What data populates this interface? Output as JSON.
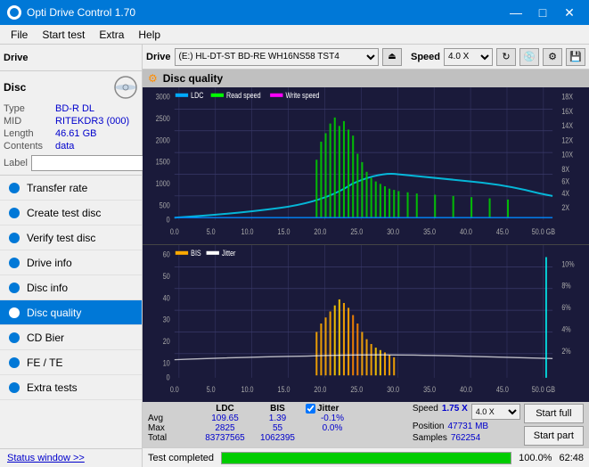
{
  "titleBar": {
    "title": "Opti Drive Control 1.70",
    "controls": [
      "minimize",
      "maximize",
      "close"
    ]
  },
  "menuBar": {
    "items": [
      "File",
      "Start test",
      "Extra",
      "Help"
    ]
  },
  "driveToolbar": {
    "driveLabel": "Drive",
    "driveValue": "(E:)  HL-DT-ST BD-RE  WH16NS58 TST4",
    "speedLabel": "Speed",
    "speedValue": "4.0 X"
  },
  "discPanel": {
    "title": "Disc",
    "rows": [
      {
        "key": "Type",
        "value": "BD-R DL"
      },
      {
        "key": "MID",
        "value": "RITEKDR3 (000)"
      },
      {
        "key": "Length",
        "value": "46.61 GB"
      },
      {
        "key": "Contents",
        "value": "data"
      }
    ],
    "labelKey": "Label"
  },
  "navItems": [
    {
      "id": "transfer-rate",
      "label": "Transfer rate",
      "active": false
    },
    {
      "id": "create-test-disc",
      "label": "Create test disc",
      "active": false
    },
    {
      "id": "verify-test-disc",
      "label": "Verify test disc",
      "active": false
    },
    {
      "id": "drive-info",
      "label": "Drive info",
      "active": false
    },
    {
      "id": "disc-info",
      "label": "Disc info",
      "active": false
    },
    {
      "id": "disc-quality",
      "label": "Disc quality",
      "active": true
    },
    {
      "id": "cd-bier",
      "label": "CD Bier",
      "active": false
    },
    {
      "id": "fe-te",
      "label": "FE / TE",
      "active": false
    },
    {
      "id": "extra-tests",
      "label": "Extra tests",
      "active": false
    }
  ],
  "statusWindow": "Status window >>",
  "qualityHeader": "Disc quality",
  "chartTop": {
    "legend": [
      {
        "label": "LDC",
        "color": "#00aaff"
      },
      {
        "label": "Read speed",
        "color": "#00ff00"
      },
      {
        "label": "Write speed",
        "color": "#ff00ff"
      }
    ],
    "yAxisLeft": [
      "3000",
      "2500",
      "2000",
      "1500",
      "1000",
      "500",
      "0"
    ],
    "yAxisRight": [
      "18X",
      "16X",
      "14X",
      "12X",
      "10X",
      "8X",
      "6X",
      "4X",
      "2X"
    ],
    "xAxis": [
      "0.0",
      "5.0",
      "10.0",
      "15.0",
      "20.0",
      "25.0",
      "30.0",
      "35.0",
      "40.0",
      "45.0",
      "50.0 GB"
    ]
  },
  "chartBottom": {
    "legend": [
      {
        "label": "BIS",
        "color": "#ffaa00"
      },
      {
        "label": "Jitter",
        "color": "#ffffff"
      }
    ],
    "yAxisLeft": [
      "60",
      "50",
      "40",
      "30",
      "20",
      "10",
      "0"
    ],
    "yAxisRight": [
      "10%",
      "8%",
      "6%",
      "4%",
      "2%"
    ],
    "xAxis": [
      "0.0",
      "5.0",
      "10.0",
      "15.0",
      "20.0",
      "25.0",
      "30.0",
      "35.0",
      "40.0",
      "45.0",
      "50.0 GB"
    ]
  },
  "statsRow": {
    "headers": [
      "",
      "LDC",
      "BIS",
      "",
      "Jitter",
      "Speed",
      "",
      ""
    ],
    "avg": {
      "ldc": "109.65",
      "bis": "1.39",
      "jitter": "-0.1%"
    },
    "max": {
      "ldc": "2825",
      "bis": "55",
      "jitter": "0.0%"
    },
    "total": {
      "ldc": "83737565",
      "bis": "1062395"
    },
    "speed": {
      "value": "1.75 X",
      "label": "Speed"
    },
    "position": {
      "value": "47731 MB",
      "label": "Position"
    },
    "samples": {
      "value": "762254",
      "label": "Samples"
    }
  },
  "controlBar": {
    "jitterChecked": true,
    "jitterLabel": "Jitter",
    "speedLabel": "Speed",
    "speedValue": "4.0 X",
    "startFullLabel": "Start full",
    "startPartLabel": "Start part"
  },
  "bottomBar": {
    "statusText": "Test completed",
    "progress": 100,
    "time": "62:48"
  }
}
